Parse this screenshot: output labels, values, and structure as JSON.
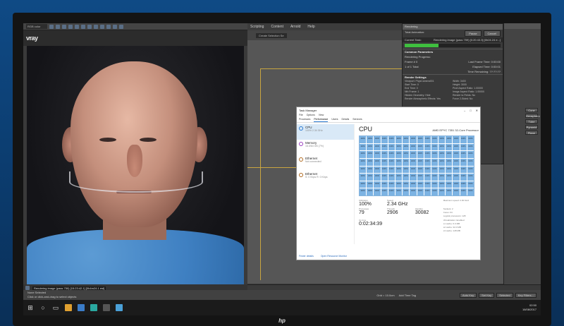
{
  "vfb": {
    "logo": "vray",
    "status_message": "Rendering image (pass 750) [15:23:42.1] [0h4m24.1 est]"
  },
  "menu": [
    "Scripting",
    "Content",
    "Arnold",
    "Help"
  ],
  "workspace_dropdown": "Create Selection Se",
  "progress": {
    "title": "Rendering",
    "total_animation": "Total Animation:",
    "pause_label": "Pause",
    "cancel_label": "Cancel",
    "current_task_label": "Current Task:",
    "current_task": "Rendering image (pass 759) [0:20:43.3] [0h24.24 e...]",
    "progress_fraction": 0.35,
    "common_params": "Common Parameters",
    "rendering_progress": "Rendering Progress:",
    "frame_label": "Frame #",
    "frame_value": "0",
    "of_label": "1 of 1",
    "total_label": "Total",
    "last_frame_time": "Last Frame Time: 0:00:00",
    "elapsed_time": "Elapsed Time: 0:00:01",
    "time_remaining": "Time Remaining: ??:??:??",
    "render_settings": "Render Settings",
    "kv": [
      "Viewport: PhysCamera001",
      "Width: 3400",
      "Start Time: 0",
      "Height: 3000",
      "End Time: 0",
      "Pixel Aspect Ratio: 1.00000",
      "Nth Frame: 1",
      "Image Aspect Ratio: 1.00000",
      "Hidden Geometry: Hide",
      "Render to Fields: No",
      "Render Atmospheric Effects: Yes",
      "Force 2-Sided: No"
    ]
  },
  "command_panel": {
    "buttons": [
      "Cone",
      "Geosphere",
      "Tube",
      "Pyramid",
      "Plane"
    ]
  },
  "task_manager": {
    "title": "Task Manager",
    "menu": [
      "File",
      "Options",
      "View"
    ],
    "tabs": [
      "Processes",
      "Performance",
      "Users",
      "Details",
      "Services"
    ],
    "side": [
      {
        "name": "CPU",
        "sub": "100% 2.34 GHz"
      },
      {
        "name": "Memory",
        "sub": "16.0/64 GB (7%)"
      },
      {
        "name": "Ethernet",
        "sub": "Not connected"
      },
      {
        "name": "Ethernet",
        "sub": "S: 0 Kbps R: 0 Kbps"
      }
    ],
    "cpu_label": "CPU",
    "cpu_model": "AMD EPYC 7351 32-Core Processor",
    "core_value": "100%",
    "stats": {
      "utilization_label": "Utilization",
      "utilization": "100%",
      "speed_label": "Speed",
      "speed": "2.34 GHz",
      "processes_label": "Processes",
      "processes": "79",
      "threads_label": "Threads",
      "threads": "2906",
      "handles_label": "Handles",
      "handles": "30082",
      "uptime_label": "Up time",
      "uptime": "0:02:34:39"
    },
    "right_stats": [
      "Maximum speed: 2.90 GHz",
      "Sockets: 2",
      "Cores: 64",
      "Logical processors: 128",
      "Virtualization: Enabled",
      "L1 cache: 6.0 MB",
      "L2 cache: 32.0 MB",
      "L3 cache: 128 MB"
    ],
    "fewer_details": "Fewer details",
    "open_monitor": "Open Resource Monitor"
  },
  "status_bar": {
    "line1": "None Selected",
    "line2": "Click or click-and-drag to select objects",
    "grid": "Grid = 10.0cm",
    "add_time_tag": "Add Time Tag",
    "auto_key": "Auto Key",
    "set_key": "Set Key",
    "selected": "Selected",
    "key_filters": "Key Filters..."
  },
  "taskbar": {
    "time": "02:50",
    "date": "16/08/2017"
  },
  "bezel_logo": "hp"
}
